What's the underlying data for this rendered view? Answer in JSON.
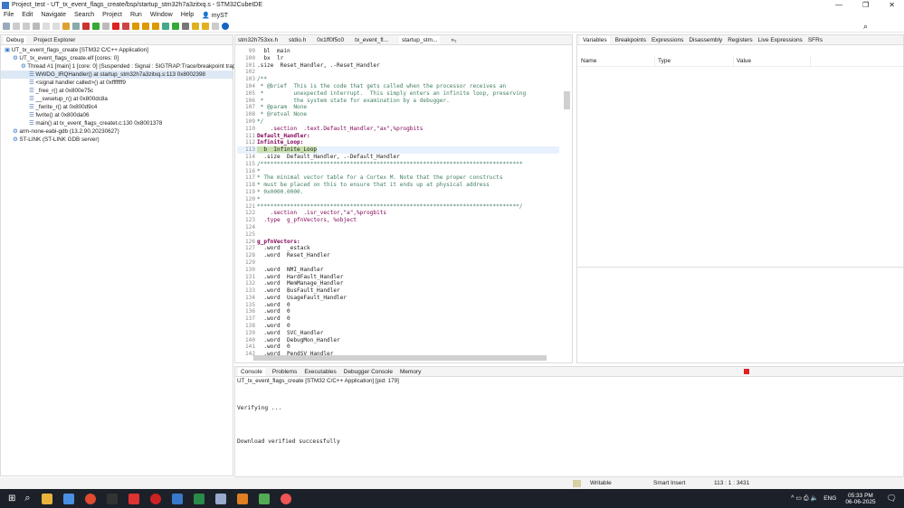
{
  "window": {
    "title": "Project_test - UT_tx_event_flags_create/bsp/startup_stm32h7a3zitxq.s - STM32CubeIDE",
    "controls": [
      "—",
      "❐",
      "✕"
    ]
  },
  "menu": [
    "File",
    "Edit",
    "Navigate",
    "Search",
    "Project",
    "Run",
    "Window",
    "Help",
    "myST"
  ],
  "debug": {
    "tabs": [
      "Debug",
      "Project Explorer"
    ],
    "tree": [
      {
        "text": "UT_tx_event_flags_create [STM32 C/C++ Application]",
        "lvl": 0
      },
      {
        "text": "UT_tx_event_flags_create.elf [cores: 0]",
        "lvl": 1
      },
      {
        "text": "Thread #1 [main] 1 [core: 0] (Suspended : Signal : SIGTRAP:Trace/breakpoint trap)",
        "lvl": 2
      },
      {
        "text": "WWDG_IRQHandler() at startup_stm32h7a3zitxq.s:113 0x8002398",
        "lvl": 3,
        "sel": true
      },
      {
        "text": "<signal handler called>() at 0xfffffff9",
        "lvl": 3
      },
      {
        "text": "_free_r() at 0x800e75c",
        "lvl": 3
      },
      {
        "text": "__swsetup_r() at 0x800dc8a",
        "lvl": 3
      },
      {
        "text": "_fwrite_r() at 0x800d9c4",
        "lvl": 3
      },
      {
        "text": "fwrite() at 0x800da06",
        "lvl": 3
      },
      {
        "text": "main() at tx_event_flags_createt.c:130 0x8001378",
        "lvl": 3
      },
      {
        "text": "arm-none-eabi-gdb (13.2.90.20230627)",
        "lvl": 1
      },
      {
        "text": "ST-LINK (ST-LINK GDB server)",
        "lvl": 1
      }
    ]
  },
  "editor": {
    "tabs": [
      "stm32h753xx.h",
      "stdio.h",
      "0x1ff0f5c0",
      "tx_event_fl...",
      "startup_stm..."
    ],
    "overflow": "»₂",
    "lines": [
      {
        "n": "99",
        "t": "  bl  main"
      },
      {
        "n": "100",
        "t": "  bx  lr"
      },
      {
        "n": "101",
        "t": ".size  Reset_Handler, .-Reset_Handler"
      },
      {
        "n": "102",
        "t": ""
      },
      {
        "n": "103",
        "t": "/**",
        "c": "c"
      },
      {
        "n": "104",
        "t": " * @brief  This is the code that gets called when the processor receives an",
        "c": "c"
      },
      {
        "n": "105",
        "t": " *         unexpected interrupt.  This simply enters an infinite loop, preserving",
        "c": "c"
      },
      {
        "n": "106",
        "t": " *         the system state for examination by a debugger.",
        "c": "c"
      },
      {
        "n": "107",
        "t": " * @param  None",
        "c": "c"
      },
      {
        "n": "108",
        "t": " * @retval None",
        "c": "c"
      },
      {
        "n": "109",
        "t": "*/",
        "c": "c"
      },
      {
        "n": "110",
        "t": "    .section  .text.Default_Handler,\"ax\",%progbits",
        "c": "k"
      },
      {
        "n": "111",
        "t": "Default_Handler:",
        "c": "lbl"
      },
      {
        "n": "112",
        "t": "Infinite_Loop:",
        "c": "lbl"
      },
      {
        "n": "113",
        "t": "  b  Infinite_Loop",
        "cur": true
      },
      {
        "n": "114",
        "t": "  .size  Default_Handler, .-Default_Handler"
      },
      {
        "n": "115",
        "t": "/*******************************************************************************",
        "c": "c"
      },
      {
        "n": "116",
        "t": "*",
        "c": "c"
      },
      {
        "n": "117",
        "t": "* The minimal vector table for a Cortex M. Note that the proper constructs",
        "c": "c"
      },
      {
        "n": "118",
        "t": "* must be placed on this to ensure that it ends up at physical address",
        "c": "c"
      },
      {
        "n": "119",
        "t": "* 0x0000.0000.",
        "c": "c"
      },
      {
        "n": "120",
        "t": "*",
        "c": "c"
      },
      {
        "n": "121",
        "t": "*******************************************************************************/",
        "c": "c"
      },
      {
        "n": "122",
        "t": "    .section  .isr_vector,\"a\",%progbits",
        "c": "k"
      },
      {
        "n": "123",
        "t": "  .type  g_pfnVectors, %object",
        "c": "k"
      },
      {
        "n": "124",
        "t": ""
      },
      {
        "n": "125",
        "t": ""
      },
      {
        "n": "126",
        "t": "g_pfnVectors:",
        "c": "lbl"
      },
      {
        "n": "127",
        "t": "  .word  _estack"
      },
      {
        "n": "128",
        "t": "  .word  Reset_Handler"
      },
      {
        "n": "129",
        "t": ""
      },
      {
        "n": "130",
        "t": "  .word  NMI_Handler"
      },
      {
        "n": "131",
        "t": "  .word  HardFault_Handler"
      },
      {
        "n": "132",
        "t": "  .word  MemManage_Handler"
      },
      {
        "n": "133",
        "t": "  .word  BusFault_Handler"
      },
      {
        "n": "134",
        "t": "  .word  UsageFault_Handler"
      },
      {
        "n": "135",
        "t": "  .word  0"
      },
      {
        "n": "136",
        "t": "  .word  0"
      },
      {
        "n": "137",
        "t": "  .word  0"
      },
      {
        "n": "138",
        "t": "  .word  0"
      },
      {
        "n": "139",
        "t": "  .word  SVC_Handler"
      },
      {
        "n": "140",
        "t": "  .word  DebugMon_Handler"
      },
      {
        "n": "141",
        "t": "  .word  0"
      },
      {
        "n": "142",
        "t": "  .word  PendSV_Handler"
      }
    ]
  },
  "variables": {
    "tabs": [
      "Variables",
      "Breakpoints",
      "Expressions",
      "Disassembly",
      "Registers",
      "Live Expressions",
      "SFRs"
    ],
    "columns": [
      "Name",
      "Type",
      "Value"
    ]
  },
  "console": {
    "tabs": [
      "Console",
      "Problems",
      "Executables",
      "Debugger Console",
      "Memory"
    ],
    "header": "UT_tx_event_flags_create [STM32 C/C++ Application]  [pid: 179]",
    "lines": [
      "Verifying ...",
      "Download verified successfully"
    ]
  },
  "statusbar": {
    "writable": "Writable",
    "insert": "Smart Insert",
    "position": "113 : 1 : 3431"
  },
  "taskbar": {
    "time": "05:33 PM",
    "date": "06-06-2025",
    "lang": "ENG"
  }
}
